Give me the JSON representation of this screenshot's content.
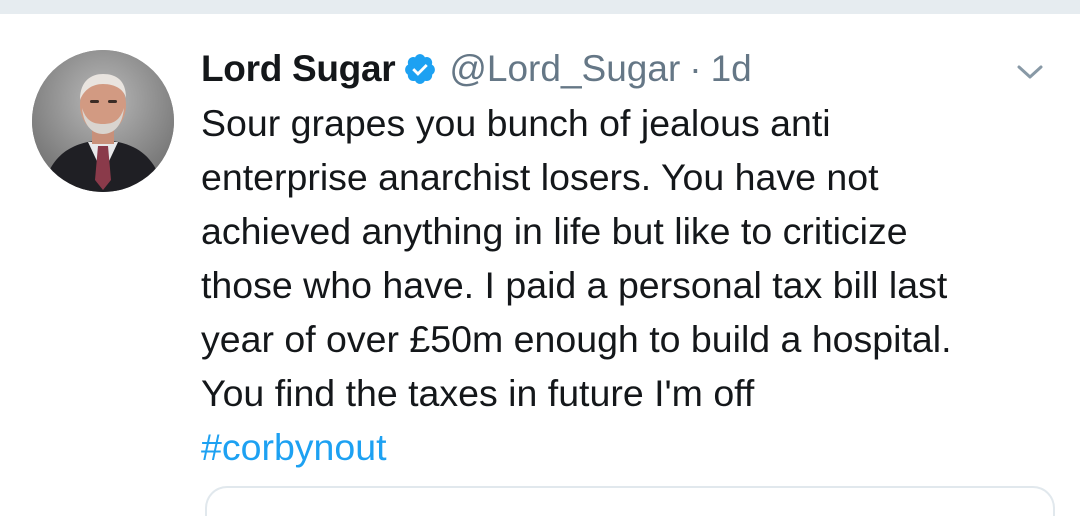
{
  "tweet": {
    "author_name": "Lord Sugar",
    "verified": true,
    "handle": "@Lord_Sugar",
    "separator": "·",
    "time": "1d",
    "body": "Sour grapes you bunch of jealous anti\nenterprise anarchist losers. You have not\nachieved anything in life but like to criticize\nthose who have. I paid a personal tax bill last\nyear of over £50m enough to build a hospital.\nYou find the taxes in future I'm off",
    "hashtag": "#corbynout"
  },
  "icons": {
    "verified": "verified-badge-icon",
    "menu": "chevron-down-icon"
  },
  "colors": {
    "text": "#14171a",
    "secondary": "#657786",
    "link": "#1da1f2",
    "verified": "#1da1f2",
    "divider": "#e6ecf0"
  }
}
